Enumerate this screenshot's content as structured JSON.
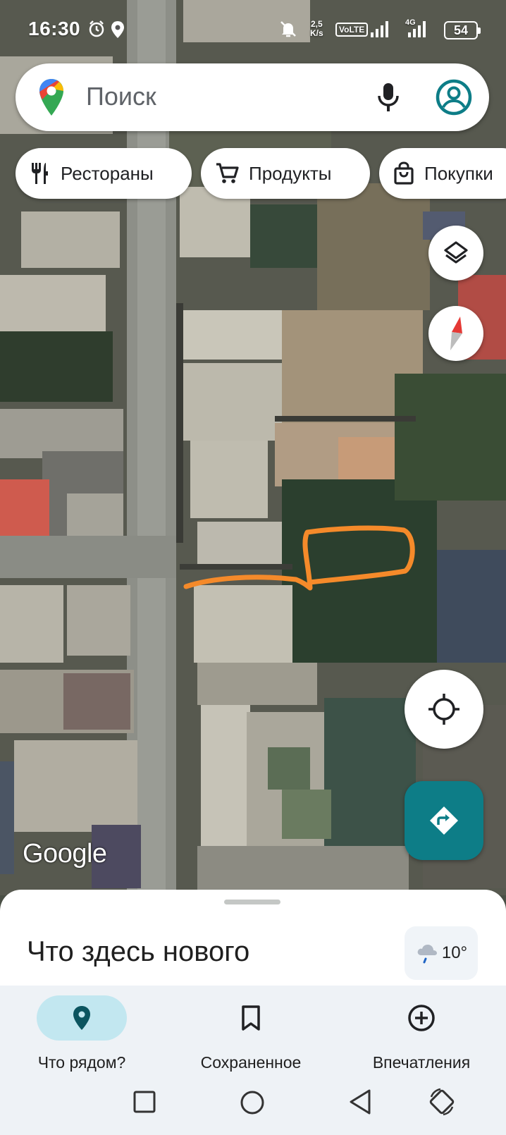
{
  "status_bar": {
    "time": "16:30",
    "net_speed_value": "2,5",
    "net_speed_unit": "K/s",
    "volte": "VoLTE",
    "network": "4G",
    "battery": "54"
  },
  "search": {
    "placeholder": "Поиск",
    "icons": [
      "maps-pin-icon",
      "mic-icon",
      "account-icon"
    ]
  },
  "chips": [
    {
      "label": "Рестораны",
      "icon": "restaurant-icon"
    },
    {
      "label": "Продукты",
      "icon": "cart-icon"
    },
    {
      "label": "Покупки",
      "icon": "shopping-bag-icon"
    }
  ],
  "map": {
    "attribution": "Google",
    "view": "satellite"
  },
  "sheet": {
    "title": "Что здесь нового",
    "temperature": "10°",
    "weather_icon": "cloud-rain-icon"
  },
  "nav": {
    "items": [
      {
        "label": "Что рядом?",
        "icon": "place-icon",
        "active": true
      },
      {
        "label": "Сохраненное",
        "icon": "bookmark-icon",
        "active": false
      },
      {
        "label": "Впечатления",
        "icon": "add-circle-icon",
        "active": false
      }
    ]
  },
  "colors": {
    "accent": "#0d7d87",
    "nav_active": "#c2e7f0",
    "annotation": "#f58a2a"
  }
}
